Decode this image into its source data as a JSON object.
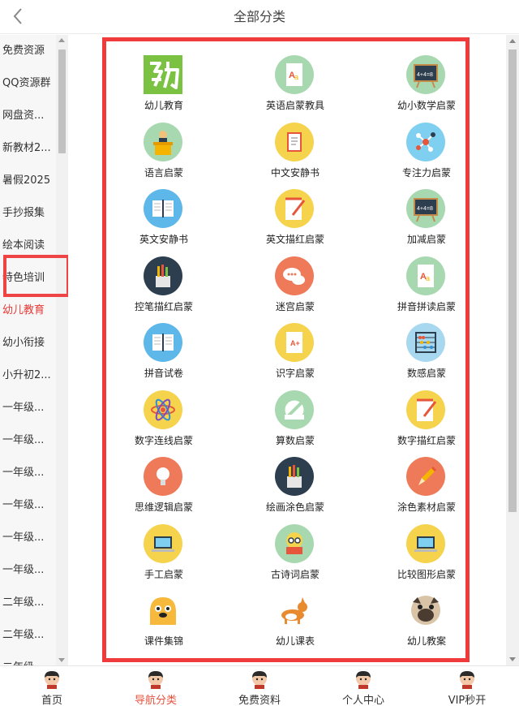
{
  "header": {
    "title": "全部分类"
  },
  "sidebar": {
    "items": [
      "免费资源",
      "QQ资源群",
      "网盘资...",
      "新教材2...",
      "暑假2025",
      "手抄报集",
      "绘本阅读",
      "特色培训",
      "幼儿教育",
      "幼小衔接",
      "小升初2...",
      "一年级...",
      "一年级...",
      "一年级...",
      "一年级...",
      "一年级...",
      "一年级...",
      "二年级...",
      "二年级...",
      "二年级..."
    ],
    "active_index": 8
  },
  "grid": {
    "items": [
      {
        "label": "幼儿教育",
        "icon": "you-logo-icon"
      },
      {
        "label": "英语启蒙教具",
        "icon": "document-aa-icon"
      },
      {
        "label": "幼小数学启蒙",
        "icon": "blackboard-icon"
      },
      {
        "label": "语言启蒙",
        "icon": "speaker-podium-icon"
      },
      {
        "label": "中文安静书",
        "icon": "book-icon"
      },
      {
        "label": "专注力启蒙",
        "icon": "molecule-icon"
      },
      {
        "label": "英文安静书",
        "icon": "open-book-icon"
      },
      {
        "label": "英文描红启蒙",
        "icon": "notepad-pencil-icon"
      },
      {
        "label": "加减启蒙",
        "icon": "blackboard-icon"
      },
      {
        "label": "控笔描红启蒙",
        "icon": "pencil-cup-icon"
      },
      {
        "label": "迷宫启蒙",
        "icon": "chat-bubble-icon"
      },
      {
        "label": "拼音拼读启蒙",
        "icon": "document-aa-icon"
      },
      {
        "label": "拼音试卷",
        "icon": "open-book-icon"
      },
      {
        "label": "识字启蒙",
        "icon": "exam-paper-icon"
      },
      {
        "label": "数感启蒙",
        "icon": "abacus-icon"
      },
      {
        "label": "数字连线启蒙",
        "icon": "atom-icon"
      },
      {
        "label": "算数启蒙",
        "icon": "ruler-icon"
      },
      {
        "label": "数字描红启蒙",
        "icon": "notepad-pencil-icon"
      },
      {
        "label": "思维逻辑启蒙",
        "icon": "light-bulb-icon"
      },
      {
        "label": "绘画涂色启蒙",
        "icon": "pencil-cup-icon"
      },
      {
        "label": "涂色素材启蒙",
        "icon": "pencil-icon"
      },
      {
        "label": "手工启蒙",
        "icon": "laptop-icon"
      },
      {
        "label": "古诗词启蒙",
        "icon": "reader-glasses-icon"
      },
      {
        "label": "比较图形启蒙",
        "icon": "laptop-icon"
      },
      {
        "label": "课件集锦",
        "icon": "jake-dog-icon"
      },
      {
        "label": "幼儿课表",
        "icon": "corgi-icon"
      },
      {
        "label": "幼儿教案",
        "icon": "pug-icon"
      }
    ]
  },
  "tabbar": {
    "items": [
      {
        "label": "首页",
        "icon": "avatar-icon"
      },
      {
        "label": "导航分类",
        "icon": "avatar-icon"
      },
      {
        "label": "免费资料",
        "icon": "avatar-icon"
      },
      {
        "label": "个人中心",
        "icon": "avatar-icon"
      },
      {
        "label": "VIP秒开",
        "icon": "avatar-icon"
      }
    ],
    "active_index": 1
  },
  "colors": {
    "accent": "#e5533d",
    "highlight": "#ef3b3b",
    "sidebar_bg": "#f7f7f7"
  }
}
